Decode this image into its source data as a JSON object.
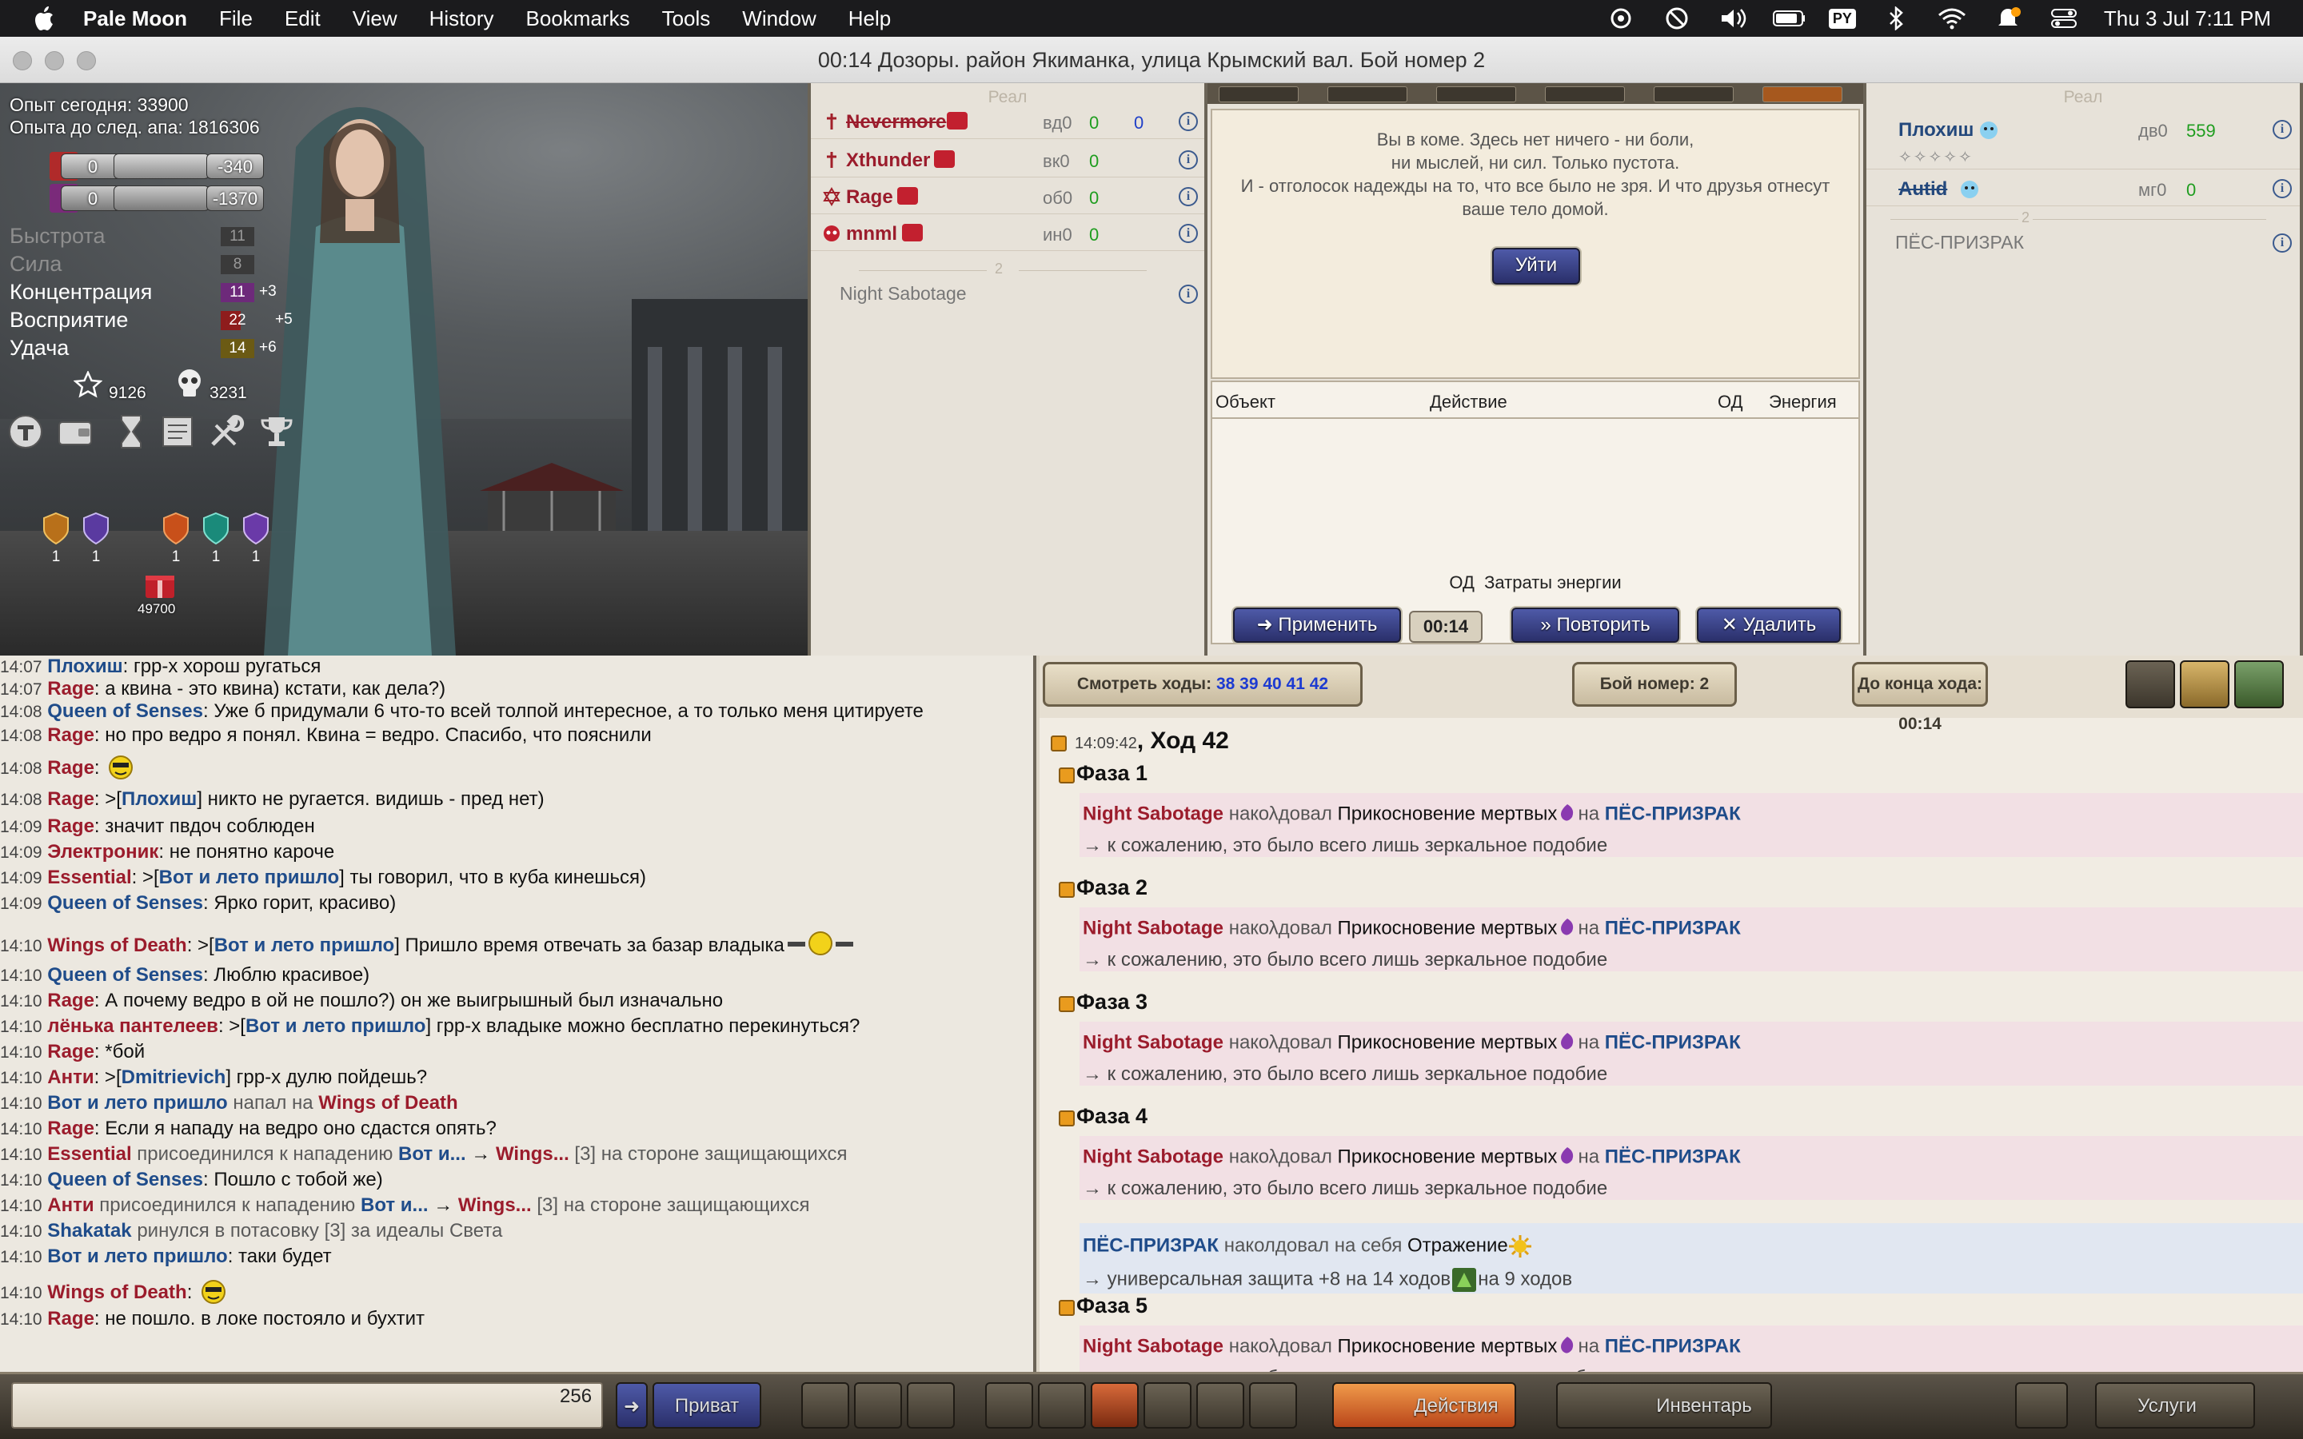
{
  "menubar": {
    "app": "Pale Moon",
    "items": [
      "File",
      "Edit",
      "View",
      "History",
      "Bookmarks",
      "Tools",
      "Window",
      "Help"
    ],
    "keyboard": "PY",
    "clock": "Thu 3 Jul  7:11 PM"
  },
  "window": {
    "title": "00:14 Дозоры. район Якиманка, улица Крымский вал. Бой номер 2"
  },
  "character": {
    "exp_today": "Опыт сегодня: 33900",
    "exp_next": "Опыта до след. апа: 1816306",
    "bars": [
      {
        "left": "0",
        "right": "-340"
      },
      {
        "left": "0",
        "right": "-1370"
      }
    ],
    "attributes": [
      {
        "name": "Быстрота",
        "value": "11",
        "bonus": "",
        "dim": true
      },
      {
        "name": "Сила",
        "value": "8",
        "bonus": "",
        "dim": true
      },
      {
        "name": "Концентрация",
        "value": "11",
        "bonus": "+3",
        "dim": false
      },
      {
        "name": "Восприятие",
        "value": "22",
        "bonus": "+5",
        "dim": false
      },
      {
        "name": "Удача",
        "value": "14",
        "bonus": "+6",
        "dim": false
      }
    ],
    "stars": "9126",
    "skulls": "3231",
    "shield_counts": [
      "1",
      "1",
      "1",
      "1",
      "1"
    ],
    "gift_value": "49700",
    "colors": {
      "attr_purple": "#6d2a7a",
      "attr_red": "#8e1c1c",
      "attr_olive": "#6b5a14"
    }
  },
  "team_left": {
    "header": "Реал",
    "fighters": [
      {
        "name": "Nevermore",
        "pos": "вд0",
        "hp": "0",
        "extra": "0",
        "struck": true
      },
      {
        "name": "Xthunder",
        "pos": "вк0",
        "hp": "0",
        "extra": "",
        "struck": false
      },
      {
        "name": "Rage",
        "pos": "об0",
        "hp": "0",
        "extra": "",
        "struck": false
      },
      {
        "name": "mnml",
        "pos": "ин0",
        "hp": "0",
        "extra": "",
        "struck": false
      }
    ],
    "group_num": "2",
    "pet": "Night Sabotage"
  },
  "team_right": {
    "header": "Реал",
    "fighters": [
      {
        "name": "Плохиш",
        "pos": "дв0",
        "hp": "559",
        "struck": false
      },
      {
        "name": "Autid",
        "pos": "мг0",
        "hp": "0",
        "struck": true
      }
    ],
    "group_num": "2",
    "pet": "ПЁС-ПРИЗРАК"
  },
  "center": {
    "coma_lines": [
      "Вы в коме. Здесь нет ничего - ни боли,",
      "ни мыслей, ни сил. Только пустота.",
      "И - отголосок надежды на то, что все было не зря. И что друзья отнесут",
      "ваше тело домой."
    ],
    "leave_button": "Уйти",
    "table_headers": {
      "object": "Объект",
      "action": "Действие",
      "od": "ОД",
      "energy": "Энергия"
    },
    "footer_od": "ОД",
    "footer_energy": "Затраты энергии",
    "apply_button": "Применить",
    "timer": "00:14",
    "repeat_button": "Повторить",
    "delete_button": "Удалить"
  },
  "log": {
    "watch_label": "Смотреть ходы:",
    "watch_turns": "38 39 40 41 42",
    "battle_number": "Бой номер: 2",
    "turn_end": "До конца хода: 00:14",
    "turn_time": "14:09:42",
    "turn_title": ", Ход 42",
    "phases": [
      "Фаза 1",
      "Фаза 2",
      "Фаза 3",
      "Фаза 4",
      "Фаза 5"
    ],
    "caster": "Night Sabotage",
    "cast_verb": "накολдовал",
    "spell": "Прикосновение мертвых",
    "prep": "на",
    "target": "ПЁС-ПРИЗРАК",
    "mirror": "→ к сожалению, это было всего лишь зеркальное подобие",
    "self_cast_name": "ПЁС-ПРИЗРАК",
    "self_cast_verb": "наколдовал на себя",
    "self_cast_spell": "Отражение",
    "defense_line": "→ универсальная защита +8 на 14 ходов",
    "defense_tail": "на 9 ходов"
  },
  "chat": [
    {
      "time": "14:07",
      "nick": "Плохиш",
      "text": "грр-х хорош ругаться",
      "nick_blue": true
    },
    {
      "time": "14:07",
      "nick": "Rage",
      "text": "а квина - это квина) кстати, как дела?)"
    },
    {
      "time": "14:08",
      "nick": "Queen of Senses",
      "text": "Уже б придумали 6 что-то всей толпой интересное, а то только меня цитируете",
      "nick_blue": true
    },
    {
      "time": "14:08",
      "nick": "Rage",
      "text": "но про ведро я понял. Квина = ведро. Спасибо, что пояснили"
    },
    {
      "time": "14:08",
      "nick": "Rage",
      "text": ""
    },
    {
      "time": "14:08",
      "nick": "Rage",
      "to": "Плохиш",
      "text": "никто не ругается. видишь - пред нет)"
    },
    {
      "time": "14:09",
      "nick": "Rage",
      "text": "значит пвдоч соблюден"
    },
    {
      "time": "14:09",
      "nick": "Электроник",
      "text": "не понятно кароче"
    },
    {
      "time": "14:09",
      "nick": "Essential",
      "to": "Вот и лето пришло",
      "text": "ты говорил, что в куба кинешься)"
    },
    {
      "time": "14:09",
      "nick": "Queen of Senses",
      "text": "Ярко горит, красиво)",
      "nick_blue": true
    },
    {
      "time": "14:10",
      "nick": "Wings of Death",
      "to": "Вот и лето пришло",
      "text": "Пришло время отвечать за базар владыка"
    },
    {
      "time": "14:10",
      "nick": "Queen of Senses",
      "text": "Люблю красивое)",
      "nick_blue": true
    },
    {
      "time": "14:10",
      "nick": "Rage",
      "text": "А почему ведро в ой не пошло?) он же выигрышный был изначально"
    },
    {
      "time": "14:10",
      "nick": "лёнька пантелеев",
      "to": "Вот и лето пришло",
      "text": "грр-х владыке можно бесплатно перекинуться?"
    },
    {
      "time": "14:10",
      "nick": "Rage",
      "text": "*бой"
    },
    {
      "time": "14:10",
      "nick": "Анти",
      "to": "Dmitrievich",
      "text": "грр-х дулю пойдешь?"
    },
    {
      "time": "14:10",
      "sys_a": "Вот и лето пришло",
      "sys_verb": "напал на",
      "sys_b": "Wings of Death"
    },
    {
      "time": "14:10",
      "nick": "Rage",
      "text": "Если я нападу на ведро оно сдастся опять?"
    },
    {
      "time": "14:10",
      "sys_a": "Essential",
      "sys_verb": "присоединился к нападению",
      "sys_c": "Вот и...",
      "sys_d": "Wings...",
      "sys_tail": "[3] на стороне защищающихся"
    },
    {
      "time": "14:10",
      "nick": "Queen of Senses",
      "text": "Пошло с тобой же)",
      "nick_blue": true
    },
    {
      "time": "14:10",
      "sys_a": "Анти",
      "sys_verb": "присоединился к нападению",
      "sys_c": "Вот и...",
      "sys_d": "Wings...",
      "sys_tail": "[3] на стороне защищающихся"
    },
    {
      "time": "14:10",
      "sys_a": "Shakatak",
      "sys_verb": "ринулся в потасовку [3] за идеалы Света",
      "sys_blue": true
    },
    {
      "time": "14:10",
      "nick": "Вот и лето пришло",
      "text": "таки будет",
      "nick_blue": true
    },
    {
      "time": "14:10",
      "nick": "Wings of Death",
      "text": ""
    },
    {
      "time": "14:10",
      "nick": "Rage",
      "text": "не пошло. в локе постояло и бухтит"
    }
  ],
  "bottombar": {
    "char_count": "256",
    "private_button": "Приват",
    "actions_button": "Действия",
    "inventory_button": "Инвентарь",
    "services_button": "Услуги"
  }
}
